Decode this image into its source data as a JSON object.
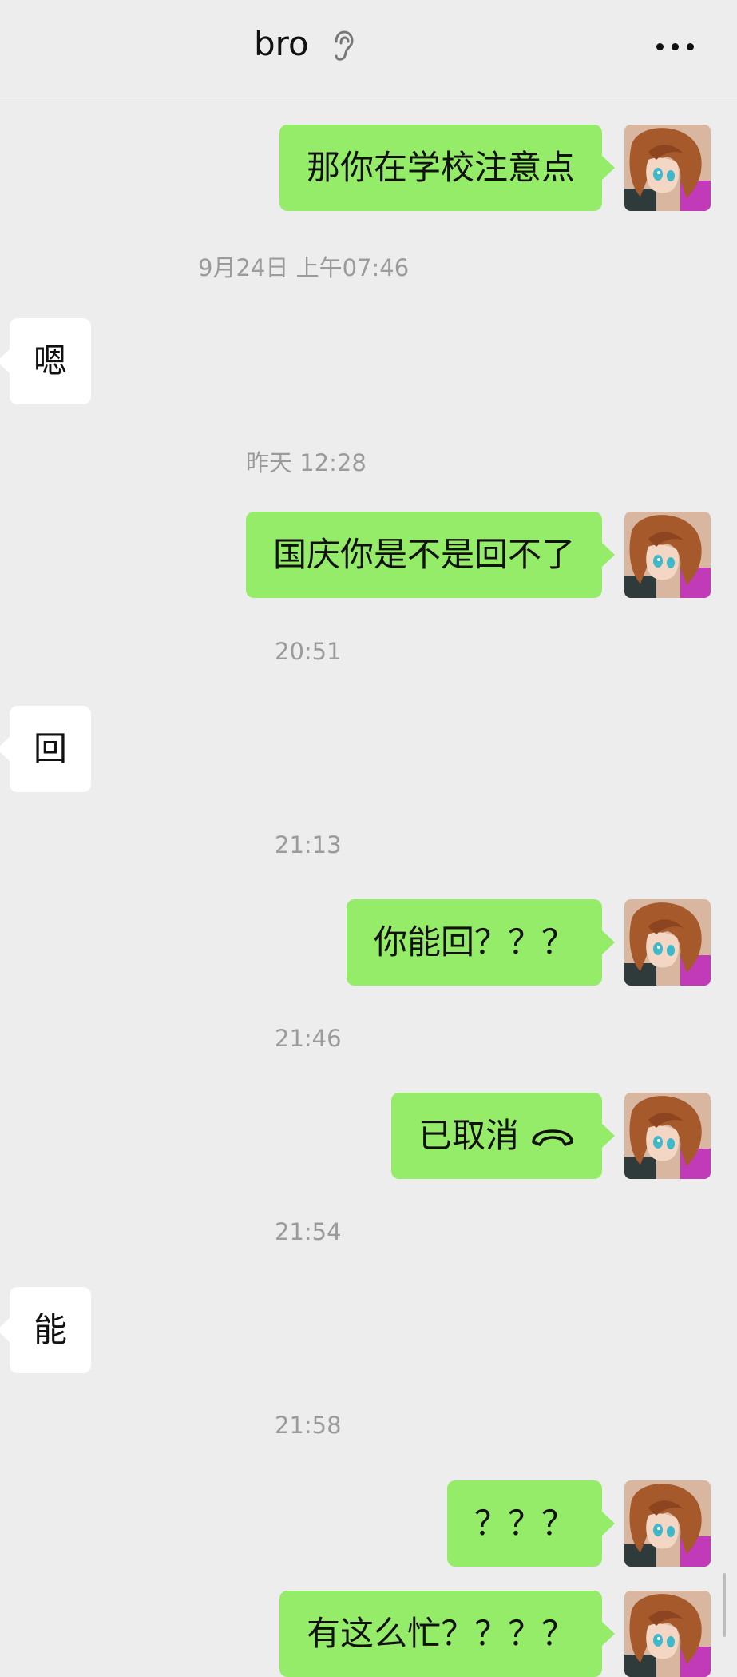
{
  "header": {
    "title": "bro"
  },
  "messages": [
    {
      "type": "outgoing",
      "text": "那你在学校注意点"
    },
    {
      "type": "timestamp",
      "text": "9月24日 上午07:46"
    },
    {
      "type": "incoming",
      "text": "嗯"
    },
    {
      "type": "timestamp",
      "text": "昨天 12:28"
    },
    {
      "type": "outgoing",
      "text": "国庆你是不是回不了"
    },
    {
      "type": "timestamp",
      "text": "20:51"
    },
    {
      "type": "incoming",
      "text": "回"
    },
    {
      "type": "timestamp",
      "text": "21:13"
    },
    {
      "type": "outgoing",
      "text": "你能回？？？"
    },
    {
      "type": "timestamp",
      "text": "21:46"
    },
    {
      "type": "outgoing",
      "text": "已取消",
      "icon": "phone-hangup-icon"
    },
    {
      "type": "timestamp",
      "text": "21:54"
    },
    {
      "type": "incoming",
      "text": "能"
    },
    {
      "type": "timestamp",
      "text": "21:58"
    },
    {
      "type": "outgoing",
      "text": "？？？"
    },
    {
      "type": "outgoing",
      "text": "有这么忙？？？？"
    }
  ],
  "colors": {
    "outgoing_bubble": "#95ec69",
    "incoming_bubble": "#ffffff",
    "background": "#ededed"
  }
}
